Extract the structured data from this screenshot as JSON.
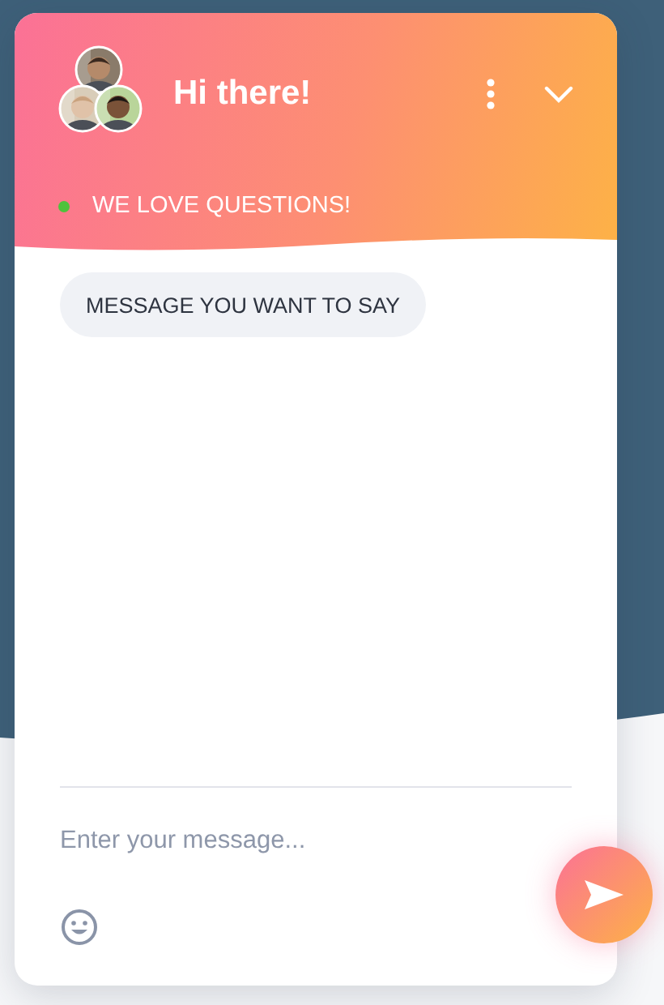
{
  "header": {
    "title": "Hi there!"
  },
  "status": {
    "online": true,
    "text": "WE LOVE QUESTIONS!"
  },
  "messages": [
    {
      "text": "MESSAGE YOU WANT TO SAY"
    }
  ],
  "composer": {
    "placeholder": "Enter your message..."
  }
}
